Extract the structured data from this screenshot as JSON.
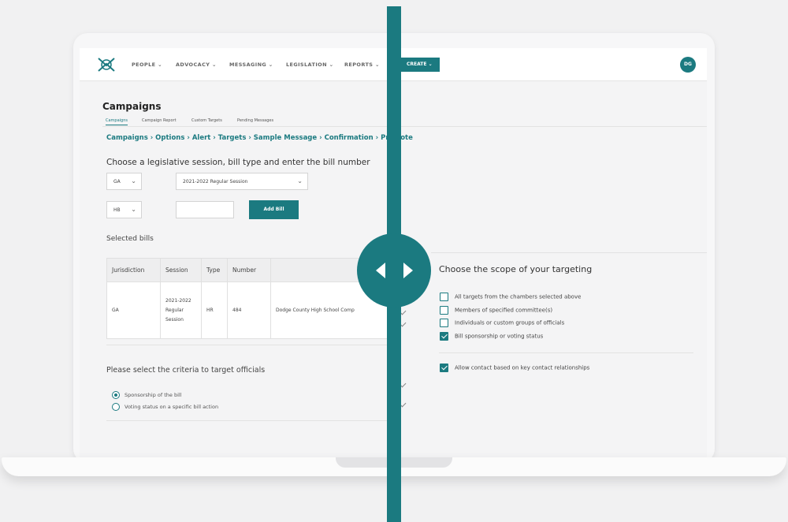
{
  "nav": {
    "items": [
      "PEOPLE",
      "ADVOCACY",
      "MESSAGING",
      "LEGISLATION",
      "REPORTS"
    ],
    "create_label": "CREATE",
    "avatar_initials": "DG"
  },
  "page": {
    "title": "Campaigns",
    "subtabs": [
      "Campaigns",
      "Campaign Report",
      "Custom Targets",
      "Pending Messages"
    ]
  },
  "breadcrumb": "Campaigns › Options › Alert › Targets › Sample Message › Confirmation › Promote",
  "bill_form": {
    "prompt": "Choose a legislative session, bill type and enter the bill number",
    "state_value": "GA",
    "session_value": "2021-2022 Regular Session",
    "type_value": "HB",
    "bill_number_value": "",
    "add_button": "Add Bill"
  },
  "selected_bills": {
    "heading": "Selected bills",
    "columns": [
      "Jurisdiction",
      "Session",
      "Type",
      "Number",
      ""
    ],
    "rows": [
      [
        "GA",
        "2021-2022 Regular Session",
        "HR",
        "484",
        "Dodge County High School Comp"
      ]
    ]
  },
  "criteria": {
    "heading": "Please select the criteria to target officials",
    "options": [
      "Sponsorship of the bill",
      "Voting status on a specific bill action"
    ],
    "selected_index": 0
  },
  "scope": {
    "heading": "Choose the scope of your targeting",
    "options": [
      {
        "label": "All targets from the chambers selected above",
        "checked": false
      },
      {
        "label": "Members of specified committee(s)",
        "checked": false
      },
      {
        "label": "Individuals or custom groups of officials",
        "checked": false
      },
      {
        "label": "Bill sponsorship or voting status",
        "checked": true
      }
    ],
    "key_contact": {
      "label": "Allow contact based on key contact relationships",
      "checked": true
    }
  },
  "colors": {
    "accent": "#1b7a80"
  }
}
